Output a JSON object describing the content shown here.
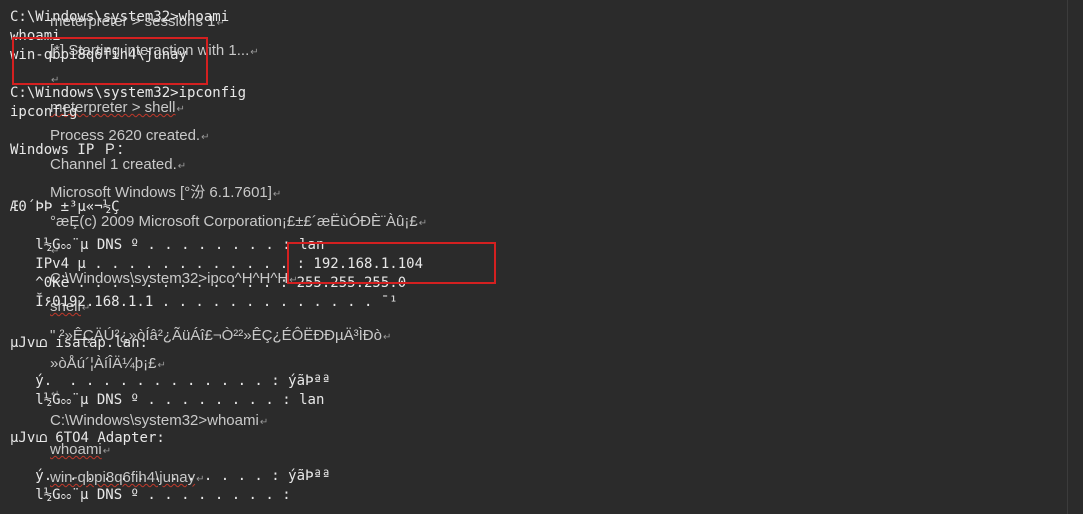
{
  "terminal": {
    "lines": [
      "C:\\Windows\\system32>whoami",
      "whoami",
      "win-qbpi8q6fih4\\junay",
      "",
      "C:\\Windows\\system32>ipconfig",
      "ipconfig",
      "",
      "Windows IP Ｐ：",
      "",
      "",
      "Æ0´ÞÞ ±³µ«¬½Ç",
      "",
      "   l½Gೲ¨µ DNS º . . . . . . . . : lan",
      "   IPv4 µ . . . . . . . . . . . . : 192.168.1.104",
      "   ^0Kë . . . . . . . . . . . . : 255.255.255.0",
      "   Ĭ۶0192.168.1.1 . . . . . . . . . . . . . ¯¹",
      "",
      "",
      "µJvഥ isatap.lan:",
      "",
      "   ý.  . . . . . . . . . . . . : ýãÞªª",
      "   l½Gೲ¨µ DNS º . . . . . . . . : lan",
      "",
      "µJvഥ 6TO4 Adapter:",
      "",
      "   ý.  . . . . . . . . . . . . : ýãÞªª",
      "   l½Gೲ¨µ DNS º . . . . . . . . :"
    ]
  },
  "ghost": {
    "lines": [
      "meterpreter > sessions 1",
      "[*] Starting interaction with 1...",
      "",
      "meterpreter > shell",
      "Process 2620 created.",
      "Channel 1 created.",
      "Microsoft Windows [°汾 6.1.7601]",
      "°æȨ(c) 2009 Microsoft Corporation¡£±£´æËùÓÐÈ¨Àû¡£",
      "",
      "C:\\Windows\\system32>ipco^H^H^H",
      "shell",
      "\" ²»ÊÇÄÚ²¿»òÍâ²¿ÃüÁî£¬Ò²²»ÊÇ¿ÉÔËÐÐµÄ³ÌÐò",
      "»òÅú´¦ÀíÎÄ¼þ¡£",
      "",
      "C:\\Windows\\system32>whoami",
      "whoami",
      "win-qbpi8q6fih4\\junay"
    ]
  }
}
